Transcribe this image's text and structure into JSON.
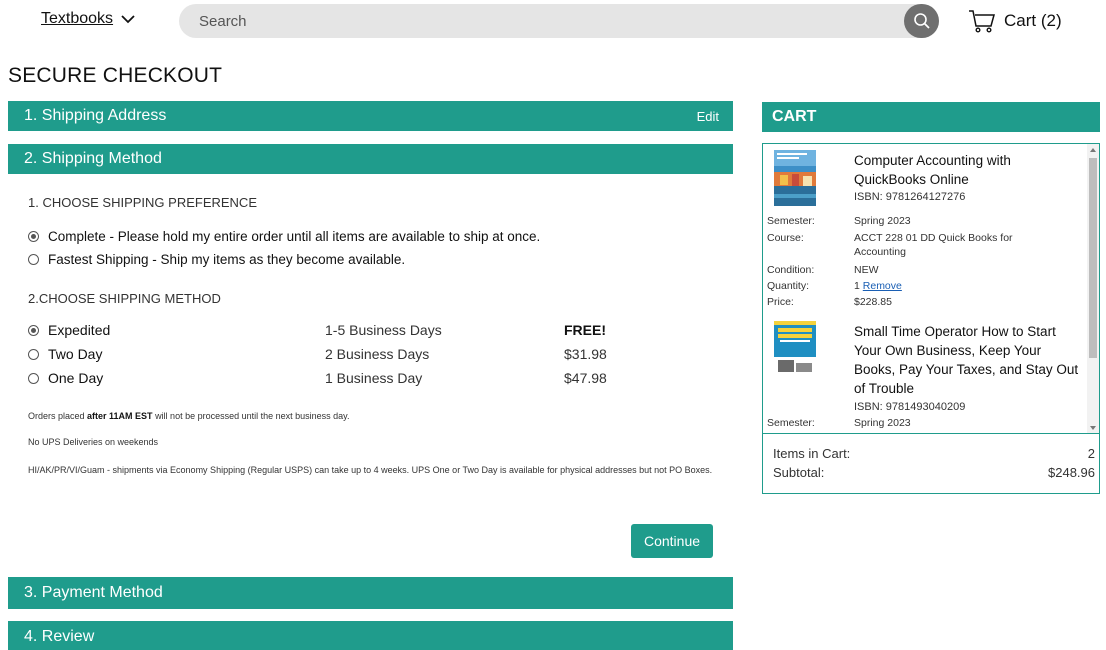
{
  "header": {
    "textbooks_label": "Textbooks",
    "search_placeholder": "Search",
    "cart_label": "Cart (2)"
  },
  "page_title": "SECURE CHECKOUT",
  "sections": {
    "shipping_address": {
      "title": "1. Shipping Address",
      "edit_label": "Edit"
    },
    "shipping_method": {
      "title": "2. Shipping Method"
    },
    "payment_method": {
      "title": "3. Payment Method"
    },
    "review": {
      "title": "4. Review"
    }
  },
  "shipping_preference": {
    "heading": "1. CHOOSE SHIPPING PREFERENCE",
    "options": [
      {
        "label": "Complete - Please hold my entire order until all items are available to ship at once.",
        "selected": true
      },
      {
        "label": "Fastest Shipping - Ship my items as they become available.",
        "selected": false
      }
    ]
  },
  "shipping_method": {
    "heading": "2.CHOOSE SHIPPING METHOD",
    "options": [
      {
        "name": "Expedited",
        "days": "1-5 Business Days",
        "price": "FREE!",
        "selected": true
      },
      {
        "name": "Two Day",
        "days": "2 Business Days",
        "price": "$31.98",
        "selected": false
      },
      {
        "name": "One Day",
        "days": "1 Business Day",
        "price": "$47.98",
        "selected": false
      }
    ]
  },
  "notes": {
    "cutoff_pre": "Orders placed ",
    "cutoff_bold": "after 11AM EST",
    "cutoff_post": " will not be processed until the next business day.",
    "weekends": "No UPS Deliveries on weekends",
    "territories": "HI/AK/PR/VI/Guam - shipments via Economy Shipping (Regular USPS) can take up to 4 weeks. UPS One or Two Day is available for physical addresses but not PO Boxes."
  },
  "continue_label": "Continue",
  "cart": {
    "title": "CART",
    "labels": {
      "semester": "Semester:",
      "course": "Course:",
      "condition": "Condition:",
      "quantity": "Quantity:",
      "price": "Price:",
      "remove": "Remove"
    },
    "items": [
      {
        "title": "Computer Accounting with QuickBooks Online",
        "isbn": "ISBN: 9781264127276",
        "semester": "Spring 2023",
        "course": "ACCT 228 01 DD Quick Books for Accounting",
        "condition": "NEW",
        "quantity": "1",
        "price": "$228.85"
      },
      {
        "title": "Small Time Operator How to Start Your Own Business, Keep Your Books, Pay Your Taxes, and Stay Out of Trouble",
        "isbn": "ISBN: 9781493040209",
        "semester": "Spring 2023"
      }
    ],
    "summary": {
      "items_label": "Items in Cart:",
      "items_value": "2",
      "subtotal_label": "Subtotal:",
      "subtotal_value": "$248.96"
    }
  },
  "colors": {
    "accent": "#1f9c8c",
    "search_bg": "#e5e5e5",
    "search_button": "#6f6f6f",
    "link": "#1a5fb4"
  }
}
